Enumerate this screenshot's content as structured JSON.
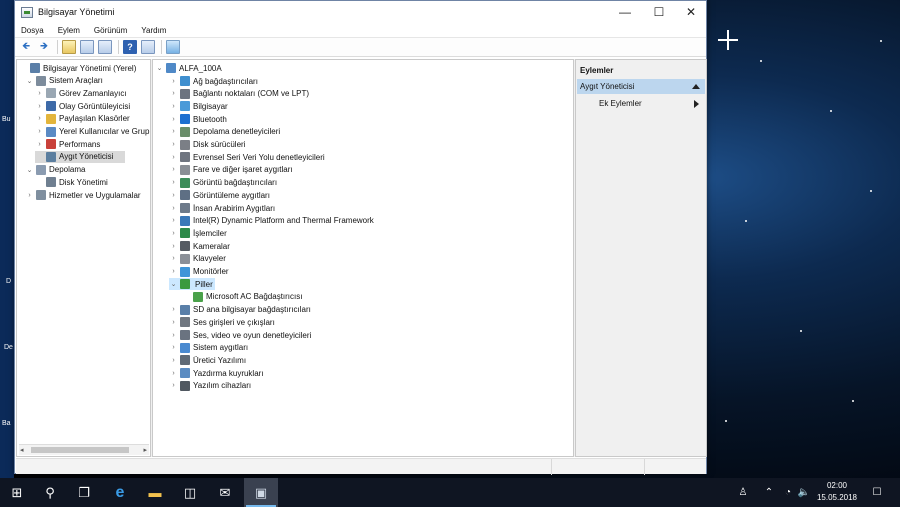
{
  "window": {
    "title": "Bilgisayar Yönetimi"
  },
  "window_controls": {
    "minimize": "—",
    "maximize": "☐",
    "close": "✕"
  },
  "menu": [
    "Dosya",
    "Eylem",
    "Görünüm",
    "Yardım"
  ],
  "toolbar": {
    "back": "🡸",
    "forward": "🡺",
    "help": "?"
  },
  "left_tree": [
    {
      "label": "Bilgisayar Yönetimi (Yerel)",
      "icon": "computer-management-icon",
      "expander": "",
      "color": "#5b7fa8"
    },
    {
      "label": "Sistem Araçları",
      "icon": "tools-icon",
      "expander": "⌄",
      "color": "#7d8c9c"
    },
    {
      "label": "Görev Zamanlayıcı",
      "icon": "clock-icon",
      "expander": "›",
      "color": "#9aa7b3"
    },
    {
      "label": "Olay Görüntüleyicisi",
      "icon": "event-viewer-icon",
      "expander": "›",
      "color": "#3d6aa8"
    },
    {
      "label": "Paylaşılan Klasörler",
      "icon": "shared-folder-icon",
      "expander": "›",
      "color": "#e3b53c"
    },
    {
      "label": "Yerel Kullanıcılar ve Grup",
      "icon": "users-icon",
      "expander": "›",
      "color": "#5a8ac4"
    },
    {
      "label": "Performans",
      "icon": "performance-icon",
      "expander": "›",
      "color": "#c9413a"
    },
    {
      "label": "Aygıt Yöneticisi",
      "icon": "device-manager-icon",
      "expander": "",
      "color": "#5b7e9f"
    },
    {
      "label": "Depolama",
      "icon": "storage-icon",
      "expander": "⌄",
      "color": "#8a9bb0"
    },
    {
      "label": "Disk Yönetimi",
      "icon": "disk-icon",
      "expander": "",
      "color": "#6f7f90"
    },
    {
      "label": "Hizmetler ve Uygulamalar",
      "icon": "services-icon",
      "expander": "›",
      "color": "#7f8f9f"
    }
  ],
  "left_scroll": {
    "left": "◂",
    "right": "▸"
  },
  "device_root": {
    "label": "ALFA_100A",
    "icon": "computer-icon",
    "expander": "⌄",
    "color": "#4f89c7"
  },
  "devices": [
    {
      "label": "Ağ bağdaştırıcıları",
      "icon": "network-adapter-icon",
      "color": "#3f8fcf"
    },
    {
      "label": "Bağlantı noktaları (COM ve LPT)",
      "icon": "port-icon",
      "color": "#6c7480"
    },
    {
      "label": "Bilgisayar",
      "icon": "pc-icon",
      "color": "#4a9ad8"
    },
    {
      "label": "Bluetooth",
      "icon": "bluetooth-icon",
      "color": "#1d6fd0"
    },
    {
      "label": "Depolama denetleyicileri",
      "icon": "storage-controller-icon",
      "color": "#6a8e6a"
    },
    {
      "label": "Disk sürücüleri",
      "icon": "disk-drive-icon",
      "color": "#7b7f86"
    },
    {
      "label": "Evrensel Seri Veri Yolu denetleyicileri",
      "icon": "usb-icon",
      "color": "#6f7580"
    },
    {
      "label": "Fare ve diğer işaret aygıtları",
      "icon": "mouse-icon",
      "color": "#8a8f96"
    },
    {
      "label": "Görüntü bağdaştırıcıları",
      "icon": "display-adapter-icon",
      "color": "#3c8d5a"
    },
    {
      "label": "Görüntüleme aygıtları",
      "icon": "camera-device-icon",
      "color": "#5e6f84"
    },
    {
      "label": "İnsan Arabirim Aygıtları",
      "icon": "hid-icon",
      "color": "#6d7a8a"
    },
    {
      "label": "Intel(R) Dynamic Platform and Thermal Framework",
      "icon": "intel-icon",
      "color": "#3a78b8"
    },
    {
      "label": "İşlemciler",
      "icon": "processor-icon",
      "color": "#2d8a4a"
    },
    {
      "label": "Kameralar",
      "icon": "camera-icon",
      "color": "#555b63"
    },
    {
      "label": "Klavyeler",
      "icon": "keyboard-icon",
      "color": "#8b9098"
    },
    {
      "label": "Monitörler",
      "icon": "monitor-icon",
      "color": "#3f95d8"
    },
    {
      "label": "Piller",
      "icon": "battery-icon",
      "color": "#3b9a3f",
      "expanded": true
    },
    {
      "label": "Microsoft AC Bağdaştırıcısı",
      "icon": "ac-adapter-icon",
      "color": "#4aa14a",
      "child": true
    },
    {
      "label": "SD ana bilgisayar bağdaştırıcıları",
      "icon": "sd-host-icon",
      "color": "#5a7fa8"
    },
    {
      "label": "Ses girişleri ve çıkışları",
      "icon": "speaker-icon",
      "color": "#707780"
    },
    {
      "label": "Ses, video ve oyun denetleyicileri",
      "icon": "sound-video-icon",
      "color": "#6a7380"
    },
    {
      "label": "Sistem aygıtları",
      "icon": "system-device-icon",
      "color": "#4a8ad0"
    },
    {
      "label": "Üretici Yazılımı",
      "icon": "firmware-icon",
      "color": "#5f6a76"
    },
    {
      "label": "Yazdırma kuyrukları",
      "icon": "print-queue-icon",
      "color": "#5b8cc2"
    },
    {
      "label": "Yazılım cihazları",
      "icon": "software-device-icon",
      "color": "#505860"
    }
  ],
  "device_expanders": {
    "collapsed": "›",
    "expanded": "⌄"
  },
  "actions": {
    "title": "Eylemler",
    "section": "Aygıt Yöneticisi",
    "item": "Ek Eylemler"
  },
  "desktop": {
    "frag1": "Bu",
    "frag2": "D",
    "frag3": "De",
    "frag4": "Ba"
  },
  "taskbar": {
    "start": "⊞",
    "search": "⚲",
    "taskview": "❐",
    "edge": "e",
    "explorer": "▬",
    "store": "◫",
    "mail": "✉",
    "compmgmt": "▣"
  },
  "tray": {
    "person": "♙",
    "chevron": "⌃",
    "network": "◔",
    "volume": "🔈",
    "notification": "☐"
  },
  "clock": {
    "time": "02:00",
    "date": "15.05.2018"
  }
}
